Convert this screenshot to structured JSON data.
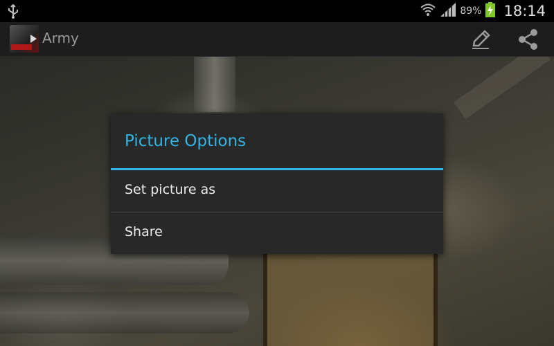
{
  "status_bar": {
    "usb_icon": "usb-icon",
    "wifi_icon": "wifi-icon",
    "signal_icon": "signal-icon",
    "battery_percent": "89%",
    "battery_icon": "battery-charging-icon",
    "time": "18:14"
  },
  "action_bar": {
    "app_icon": "app-icon",
    "title": "Army",
    "actions": [
      {
        "name": "edit",
        "icon": "pencil-icon"
      },
      {
        "name": "share",
        "icon": "share-icon"
      }
    ]
  },
  "dialog": {
    "title": "Picture Options",
    "items": [
      {
        "label": "Set picture as"
      },
      {
        "label": "Share"
      }
    ]
  },
  "colors": {
    "accent": "#33b5e5",
    "dialog_bg": "#282828",
    "action_bar_bg": "#1d1d1d",
    "battery_green": "#7fc629"
  }
}
